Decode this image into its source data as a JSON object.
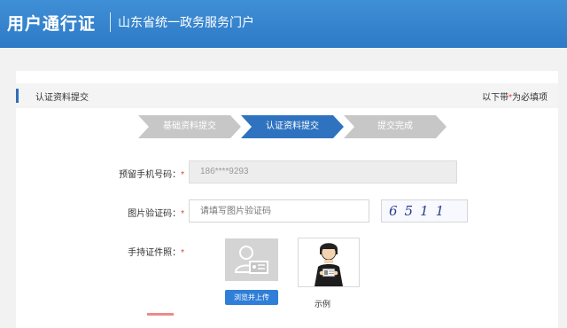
{
  "header": {
    "brand": "用户通行证",
    "portal_name": "山东省统一政务服务门户"
  },
  "section": {
    "title": "认证资料提交",
    "required_note_prefix": "以下带",
    "required_star": "*",
    "required_note_suffix": "为必填项"
  },
  "steps": [
    {
      "label": "基础资料提交"
    },
    {
      "label": "认证资料提交"
    },
    {
      "label": "提交完成"
    }
  ],
  "form": {
    "phone_label": "预留手机号码：",
    "phone_value": "186****9293",
    "captcha_label": "图片验证码：",
    "captcha_placeholder": "请填写图片验证码",
    "captcha_text": "6511",
    "photo_label": "手持证件照：",
    "upload_button": "浏览并上传",
    "example_label": "示例",
    "required_star": "*"
  },
  "colors": {
    "header_blue": "#2d7ac6",
    "active_step": "#2f73c0",
    "inactive_step": "#c7c7c7",
    "required_red": "#e23b3b"
  },
  "icons": [
    "id-card-placeholder-icon",
    "person-holding-id-icon"
  ]
}
